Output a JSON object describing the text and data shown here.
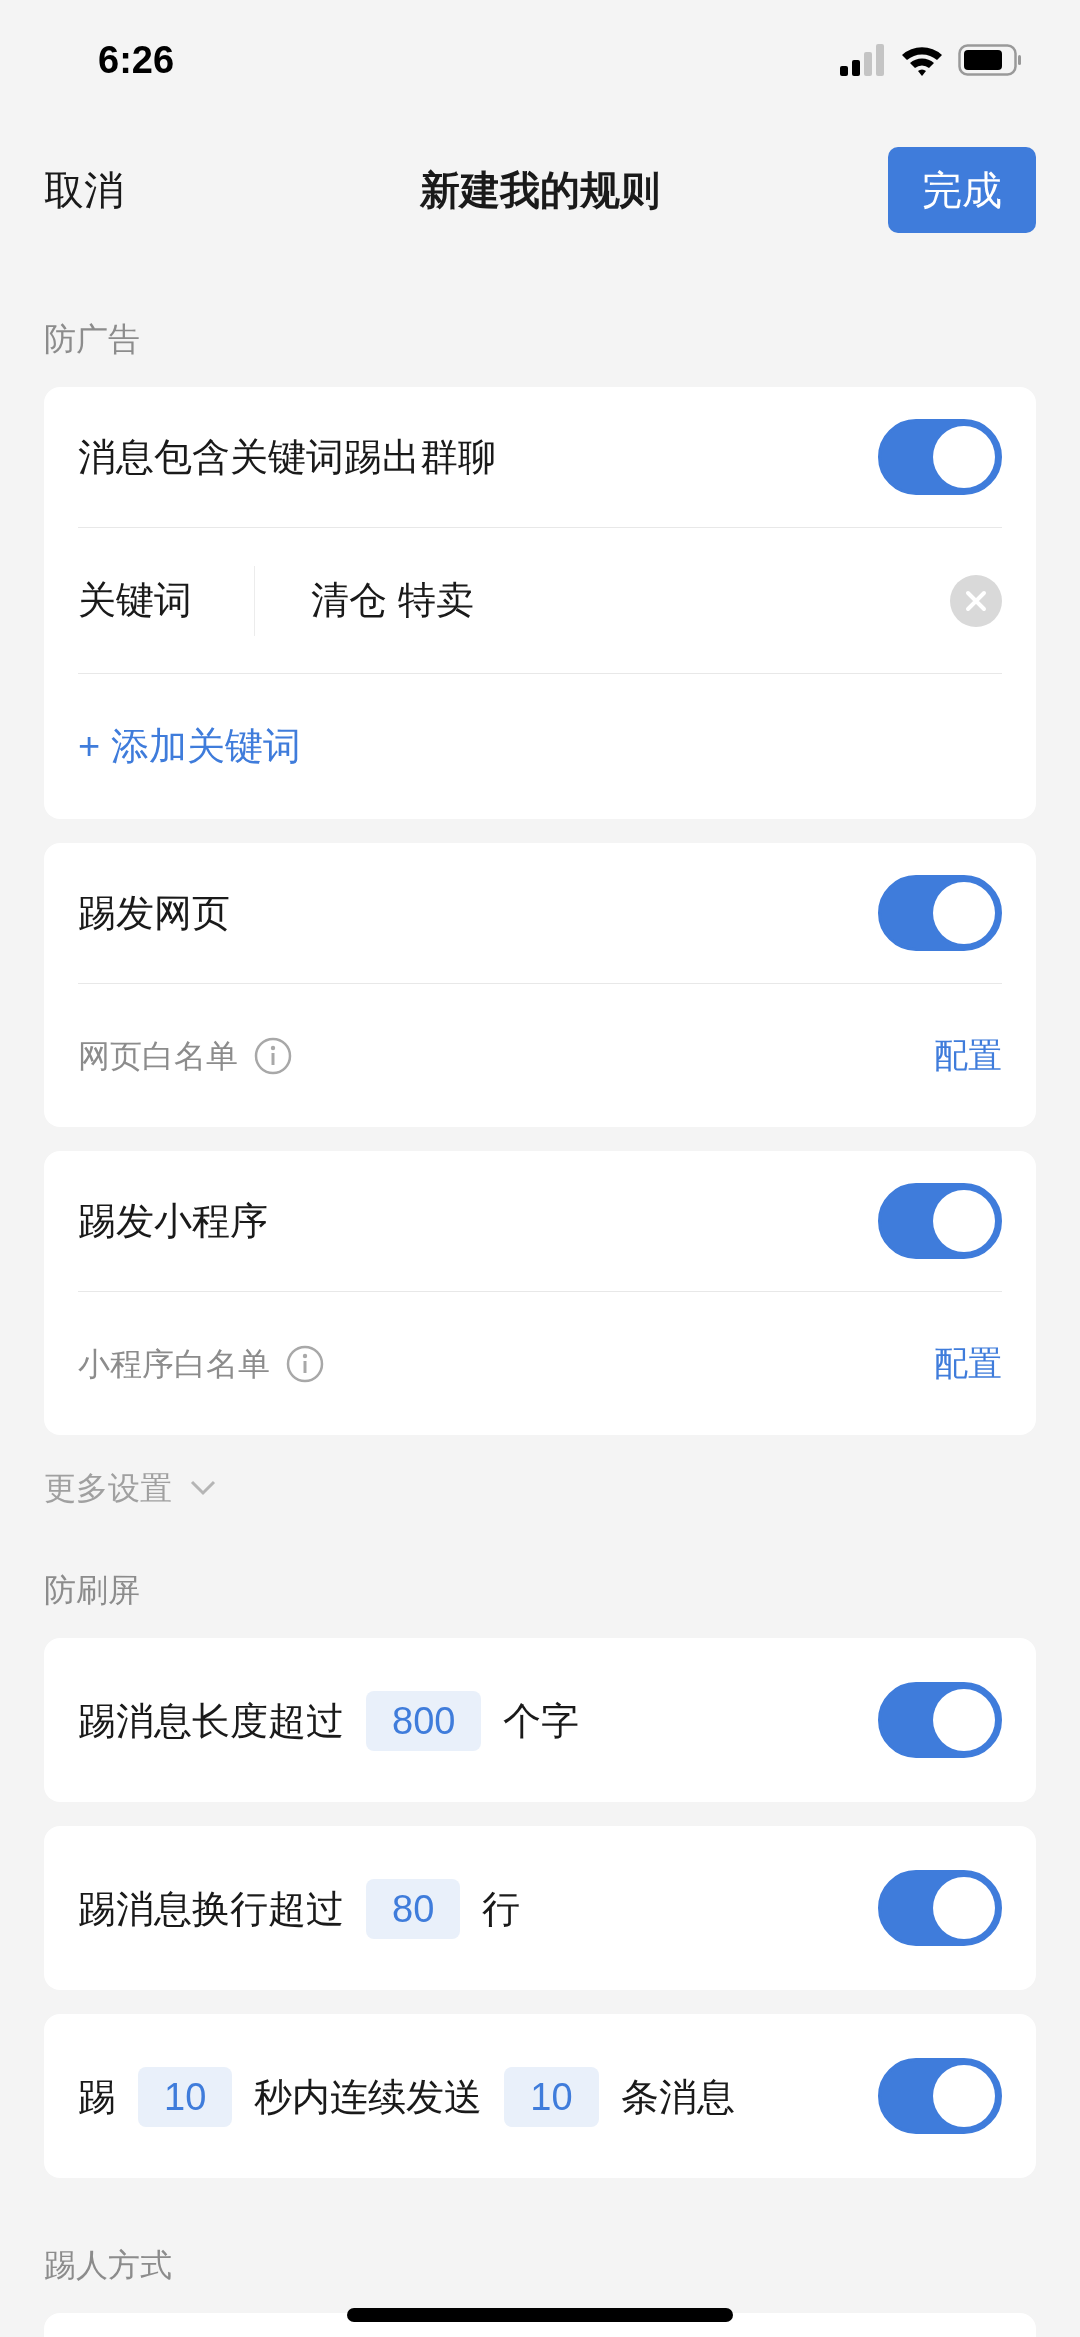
{
  "status_bar": {
    "time": "6:26"
  },
  "nav": {
    "cancel": "取消",
    "title": "新建我的规则",
    "done": "完成"
  },
  "blocks": [
    {
      "kind": "header",
      "title": "防广告"
    },
    {
      "kind": "card",
      "rows": [
        {
          "kind": "toggle",
          "label": "消息包含关键词踢出群聊",
          "on": true
        },
        {
          "kind": "keyword",
          "label": "关键词",
          "value": "清仓 特卖"
        },
        {
          "kind": "add",
          "label": "+ 添加关键词"
        }
      ]
    },
    {
      "kind": "card",
      "rows": [
        {
          "kind": "toggle",
          "label": "踢发网页",
          "on": true
        },
        {
          "kind": "whitelist",
          "label": "网页白名单",
          "action": "配置"
        }
      ]
    },
    {
      "kind": "card",
      "rows": [
        {
          "kind": "toggle",
          "label": "踢发小程序",
          "on": true
        },
        {
          "kind": "whitelist",
          "label": "小程序白名单",
          "action": "配置"
        }
      ]
    },
    {
      "kind": "more",
      "label": "更多设置",
      "expanded": false
    },
    {
      "kind": "header",
      "title": "防刷屏"
    },
    {
      "kind": "card",
      "rows": [
        {
          "kind": "rule",
          "on": true,
          "segments": [
            {
              "kind": "text",
              "text": "踢消息长度超过"
            },
            {
              "kind": "value",
              "text": "800"
            },
            {
              "kind": "text",
              "text": "个字"
            }
          ]
        }
      ]
    },
    {
      "kind": "card",
      "rows": [
        {
          "kind": "rule",
          "on": true,
          "segments": [
            {
              "kind": "text",
              "text": "踢消息换行超过"
            },
            {
              "kind": "value",
              "text": "80"
            },
            {
              "kind": "text",
              "text": "行"
            }
          ]
        }
      ]
    },
    {
      "kind": "card",
      "rows": [
        {
          "kind": "rule",
          "on": true,
          "segments": [
            {
              "kind": "text",
              "text": "踢"
            },
            {
              "kind": "value",
              "text": "10"
            },
            {
              "kind": "text",
              "text": "秒内连续发送"
            },
            {
              "kind": "value",
              "text": "10"
            },
            {
              "kind": "text",
              "text": "条消息"
            }
          ]
        }
      ]
    },
    {
      "kind": "header",
      "title": "踢人方式"
    },
    {
      "kind": "card_edge"
    }
  ]
}
